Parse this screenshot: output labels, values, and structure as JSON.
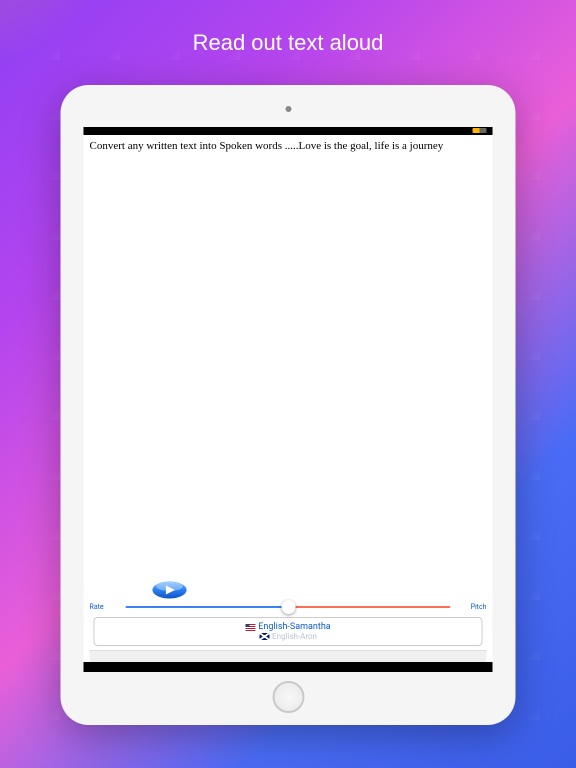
{
  "promo": {
    "title": "Read out text aloud"
  },
  "textArea": {
    "value": "Convert any written text into Spoken words .....Love is the goal, life is a journey"
  },
  "controls": {
    "rateLabel": "Rate",
    "pitchLabel": "Pitch",
    "sliderPosition": 50
  },
  "voices": [
    {
      "flag": "us",
      "label": "English-Samantha"
    },
    {
      "flag": "gb",
      "label": "English-Aron"
    }
  ]
}
